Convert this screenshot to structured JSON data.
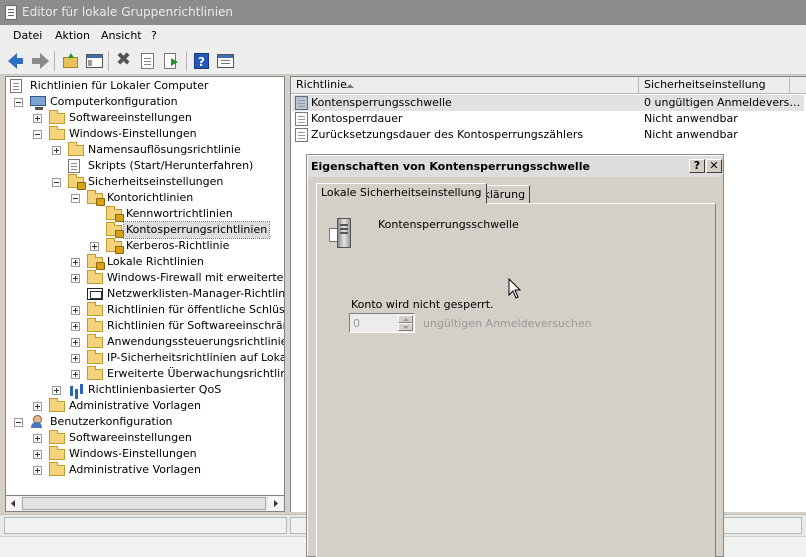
{
  "window": {
    "title": "Editor für lokale Gruppenrichtlinien"
  },
  "menu": [
    "Datei",
    "Aktion",
    "Ansicht",
    "?"
  ],
  "toolbar": {
    "icons": [
      "back-icon",
      "forward-icon",
      "folder-up-icon",
      "show-hide-tree-icon",
      "delete-icon",
      "properties-doc-icon",
      "export-list-icon",
      "help-icon",
      "console-properties-icon"
    ]
  },
  "tree": [
    {
      "label": "Richtlinien für Lokaler Computer",
      "icon": "policy-doc-icon",
      "level": 0
    },
    {
      "label": "Computerkonfiguration",
      "icon": "computer-icon",
      "level": 1,
      "expander": "minus"
    },
    {
      "label": "Softwareeinstellungen",
      "icon": "folder-icon",
      "level": 2,
      "expander": "plus"
    },
    {
      "label": "Windows-Einstellungen",
      "icon": "folder-icon",
      "level": 2,
      "expander": "minus"
    },
    {
      "label": "Namensauflösungsrichtlinie",
      "icon": "folder-icon",
      "level": 3,
      "expander": "plus"
    },
    {
      "label": "Skripts (Start/Herunterfahren)",
      "icon": "script-icon",
      "level": 3
    },
    {
      "label": "Sicherheitseinstellungen",
      "icon": "lock-folder-icon",
      "level": 3,
      "expander": "minus"
    },
    {
      "label": "Kontorichtlinien",
      "icon": "lock-folder-icon",
      "level": 4,
      "expander": "minus"
    },
    {
      "label": "Kennwortrichtlinien",
      "icon": "lock-folder-icon",
      "level": 5
    },
    {
      "label": "Kontosperrungsrichtlinien",
      "icon": "lock-folder-icon",
      "level": 5,
      "selected": true
    },
    {
      "label": "Kerberos-Richtlinie",
      "icon": "lock-folder-icon",
      "level": 5,
      "expander": "plus"
    },
    {
      "label": "Lokale Richtlinien",
      "icon": "lock-folder-icon",
      "level": 4,
      "expander": "plus"
    },
    {
      "label": "Windows-Firewall mit erweiterter Sich",
      "icon": "folder-icon",
      "level": 4,
      "expander": "plus"
    },
    {
      "label": "Netzwerklisten-Manager-Richtlinien",
      "icon": "network-icon",
      "level": 4
    },
    {
      "label": "Richtlinien für öffentliche Schlüssel",
      "icon": "folder-icon",
      "level": 4,
      "expander": "plus"
    },
    {
      "label": "Richtlinien für Softwareeinschränkung",
      "icon": "folder-icon",
      "level": 4,
      "expander": "plus"
    },
    {
      "label": "Anwendungssteuerungsrichtlinien",
      "icon": "folder-icon",
      "level": 4,
      "expander": "plus"
    },
    {
      "label": "IP-Sicherheitsrichtlinien auf Lokaler C",
      "icon": "folder-icon",
      "level": 4,
      "expander": "plus"
    },
    {
      "label": "Erweiterte Überwachungsrichtlinienk",
      "icon": "folder-icon",
      "level": 4,
      "expander": "plus"
    },
    {
      "label": "Richtlinienbasierter QoS",
      "icon": "chart-icon",
      "level": 3,
      "expander": "plus"
    },
    {
      "label": "Administrative Vorlagen",
      "icon": "folder-icon",
      "level": 2,
      "expander": "plus"
    },
    {
      "label": "Benutzerkonfiguration",
      "icon": "user-icon",
      "level": 1,
      "expander": "minus"
    },
    {
      "label": "Softwareeinstellungen",
      "icon": "folder-icon",
      "level": 2,
      "expander": "plus"
    },
    {
      "label": "Windows-Einstellungen",
      "icon": "folder-icon",
      "level": 2,
      "expander": "plus"
    },
    {
      "label": "Administrative Vorlagen",
      "icon": "folder-icon",
      "level": 2,
      "expander": "plus"
    }
  ],
  "list": {
    "columns": [
      "Richtlinie",
      "Sicherheitseinstellung"
    ],
    "rows": [
      {
        "policy": "Kontensperrungsschwelle",
        "setting": "0 ungültigen Anmeldevers…",
        "selected": true
      },
      {
        "policy": "Kontosperrdauer",
        "setting": "Nicht anwendbar"
      },
      {
        "policy": "Zurücksetzungsdauer des Kontosperrungszählers",
        "setting": "Nicht anwendbar"
      }
    ]
  },
  "dialog": {
    "title": "Eigenschaften von Kontensperrungsschwelle",
    "help_label": "?",
    "close_label": "✕",
    "tabs": [
      "Lokale Sicherheitseinstellung",
      "Erklärung"
    ],
    "policy_name": "Kontensperrungsschwelle",
    "status_text": "Konto wird nicht gesperrt.",
    "spinner_value": "0",
    "spinner_unit": "ungültigen Anmeldeversuchen"
  }
}
